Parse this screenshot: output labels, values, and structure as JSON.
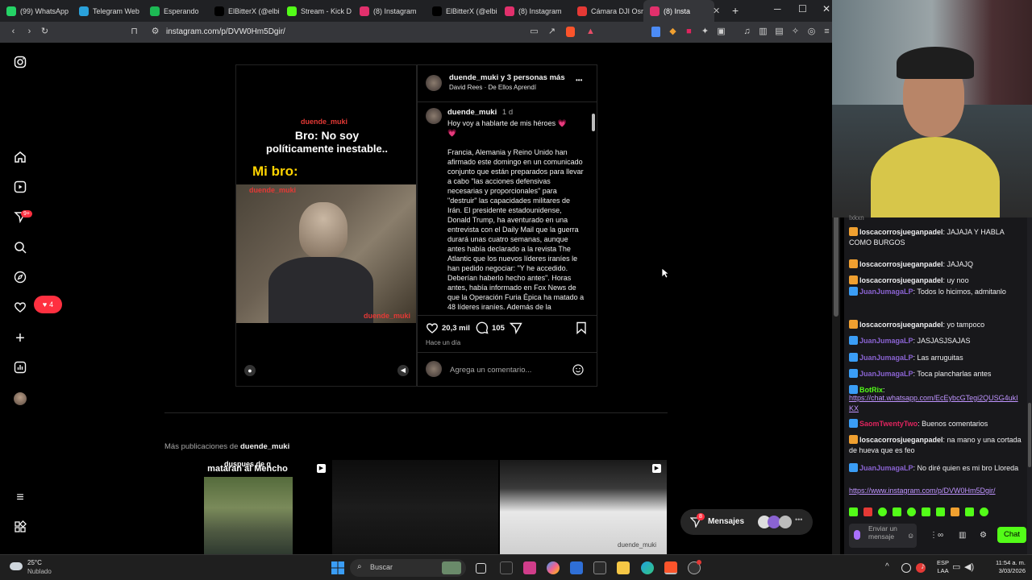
{
  "browser": {
    "tabs": [
      {
        "label": "(99) WhatsApp",
        "color": "#25d366"
      },
      {
        "label": "Telegram Web",
        "color": "#2aa1da"
      },
      {
        "label": "Esperando",
        "color": "#1db954"
      },
      {
        "label": "ElBitterX (@elbi",
        "color": "#000000"
      },
      {
        "label": "Stream - Kick D",
        "color": "#53fc18"
      },
      {
        "label": "(8) Instagram",
        "color": "#e1306c"
      },
      {
        "label": "ElBitterX (@elbi",
        "color": "#000000"
      },
      {
        "label": "(8) Instagram",
        "color": "#e1306c"
      },
      {
        "label": "Cámara DJI Osr",
        "color": "#e53935"
      },
      {
        "label": "(8) Insta",
        "color": "#e1306c"
      }
    ],
    "url": "instagram.com/p/DVW0Hm5Dgir/",
    "new_tab": "+",
    "minimize": "─",
    "maximize": "☐",
    "close": "✕"
  },
  "instagram": {
    "sidebar": {
      "badge_reels": "9+",
      "badge_likes": "4"
    },
    "post": {
      "header_user": "duende_muki y 3 personas más",
      "header_sub": "David Rees · De Ellos Aprendí",
      "more": "•••",
      "media": {
        "watermark_top": "duende_muki",
        "line1": "Bro: No soy",
        "line2": "políticamente inestable..",
        "line3": "Mi bro:",
        "watermark_mid": "duende_muki",
        "watermark_bottom": "duende_muki"
      },
      "caption_user": "duende_muki",
      "caption_time": "1 d",
      "caption_first": "Hoy voy a hablarte de mis héroes 💗",
      "caption_heart": "💗",
      "caption_body": "Francia, Alemania y Reino Unido han afirmado este domingo en un comunicado conjunto que están preparados para llevar a cabo \"las acciones defensivas necesarias y proporcionales\" para \"destruir\" las capacidades militares de Irán. El presidente estadounidense, Donald Trump, ha aventurado en una entrevista con el Daily Mail que la guerra durará unas cuatro semanas, aunque antes había declarado a la revista The Atlantic que los nuevos líderes iraníes le han pedido negociar: \"Y he accedido. Deberían haberlo hecho antes\". Horas antes, había informado en Fox News de que la Operación Furia Épica ha matado a 48 líderes iraníes. Además de la",
      "likes": "20,3 mil",
      "comments": "105",
      "time_ago": "Hace un día",
      "comment_placeholder": "Agrega un comentario..."
    },
    "more_posts": {
      "prefix": "Más publicaciones de ",
      "user": "duende_muki",
      "thumb1_text1": "duspues de q",
      "thumb1_text2": "mataran al Mencho",
      "thumb3_watermark": "duende_muki"
    },
    "messages_label": "Mensajes",
    "messages_badge": "8"
  },
  "chat": {
    "cut_top": "Ixkxn",
    "messages": [
      {
        "user": "loscacorrosjueganpadel",
        "text": ": JAJAJA Y HABLA COMO BURGOS",
        "color": "#efeff1"
      },
      {
        "user": "loscacorrosjueganpadel",
        "text": ": JAJAJQ",
        "color": "#efeff1"
      },
      {
        "user": "loscacorrosjueganpadel",
        "text": ": uy noo",
        "color": "#efeff1"
      },
      {
        "user": "JuanJumagaLP",
        "text": ": Todos lo hicimos, admitanlo",
        "color": "#8a63d2"
      },
      {
        "user": "loscacorrosjueganpadel",
        "text": ": yo tampoco",
        "color": "#efeff1"
      },
      {
        "user": "JuanJumagaLP",
        "text": ": JASJASJSAJAS",
        "color": "#8a63d2"
      },
      {
        "user": "JuanJumagaLP",
        "text": ": Las arruguitas",
        "color": "#8a63d2"
      },
      {
        "user": "JuanJumagaLP",
        "text": ": Toca plancharlas antes",
        "color": "#8a63d2"
      },
      {
        "user": "BotRix",
        "text": ":",
        "color": "#53fc18"
      },
      {
        "user": "SaomTwentyTwo",
        "text": ": Buenos comentarios",
        "color": "#e0245e"
      },
      {
        "user": "loscacorrosjueganpadel",
        "text": ": na mano y una cortada de hueva que es feo",
        "color": "#efeff1"
      },
      {
        "user": "JuanJumagaLP",
        "text": ": No diré quien es mi bro Lloreda",
        "color": "#8a63d2"
      }
    ],
    "botrix_link": "https://chat.whatsapp.com/EcEybcGTegi2QUSG4ukIKX",
    "last_link": "https://www.instagram.com/p/DVW0Hm5Dgir/",
    "input_placeholder": "Enviar un mensaje",
    "send_label": "Chat"
  },
  "taskbar": {
    "weather_temp": "25°C",
    "weather_text": "Nublado",
    "search_label": "Buscar",
    "lang1": "ESP",
    "lang2": "LAA",
    "time": "11:54 a. m.",
    "date": "3/03/2026"
  }
}
